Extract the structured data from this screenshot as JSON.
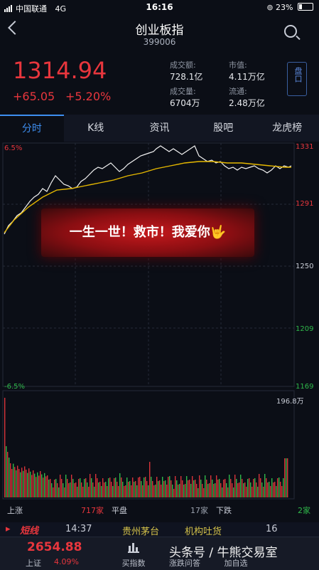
{
  "status_bar": {
    "carrier": "中国联通",
    "network": "4G",
    "time": "16:16",
    "battery": "23%"
  },
  "header": {
    "title": "创业板指",
    "code": "399006"
  },
  "quote": {
    "price": "1314.94",
    "change": "+65.05",
    "change_pct": "+5.20%",
    "turnover_label": "成交额:",
    "turnover": "728.1亿",
    "mktcap_label": "市值:",
    "mktcap": "4.11万亿",
    "volume_label": "成交量:",
    "volume": "6704万",
    "float_label": "流通:",
    "float": "2.48万亿",
    "side_button": "盘口"
  },
  "tabs": [
    "分时",
    "K线",
    "资讯",
    "股吧",
    "龙虎榜"
  ],
  "chart": {
    "left_top": "6.5%",
    "left_bottom": "-6.5%",
    "right_ticks": [
      "1331",
      "1291",
      "1250",
      "1209",
      "1169"
    ],
    "volume_max": "196.8万",
    "banner_text": "一生一世！救市！我爱你🤟"
  },
  "breadth": {
    "up_label": "上涨",
    "up_count": "717家",
    "flat_label": "平盘",
    "flat_count": "17家",
    "down_label": "下跌",
    "down_count": "2家"
  },
  "ticker": {
    "tag": "短线",
    "time": "14:37",
    "stock": "贵州茅台",
    "event": "机构吐货",
    "num": "16"
  },
  "bottom_nav": {
    "index_value": "2654.88",
    "index_name": "上证",
    "index_pct": "4.09%",
    "items": [
      "买指数",
      "涨跌问答",
      "加自选"
    ],
    "watermark": "头条号 / 牛熊交易室"
  },
  "colors": {
    "up": "#e8363d",
    "down": "#2fb84a",
    "accent": "#3e8ef0",
    "avg_line": "#e6b800"
  }
}
